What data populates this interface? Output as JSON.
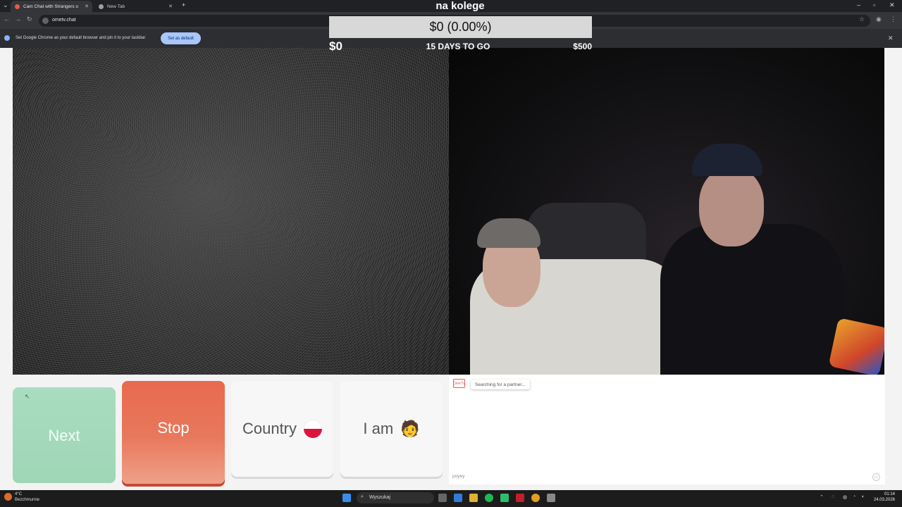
{
  "browser": {
    "tabs": [
      {
        "label": "Cam Chat with Strangers o",
        "active": true
      },
      {
        "label": "New Tab",
        "active": false
      }
    ],
    "new_tab_symbol": "+",
    "url": "ometv.chat",
    "infobar_text": "Set Google Chrome as your default browser and pin it to your taskbar",
    "set_default_label": "Set as default"
  },
  "overlay": {
    "title": "na kolege",
    "goal_text": "$0 (0.00%)",
    "goal_current": "$0",
    "days_to_go": "15 DAYS TO GO",
    "goal_target": "$500",
    "progress_fraction": 0.0
  },
  "controls": {
    "next_label": "Next",
    "stop_label": "Stop",
    "country_label": "Country",
    "country_flag": "flag-poland-icon",
    "iam_label": "I am",
    "iam_icon": "person-emoji-icon"
  },
  "chat": {
    "status": "Searching for a partner...",
    "input_text": "poyey",
    "logo_text": "OmeTV"
  },
  "taskbar": {
    "weather_temp": "4°C",
    "weather_desc": "Bezchmurnie",
    "search_label": "Wyszukaj",
    "time": "01:14",
    "date": "24.03.2026"
  },
  "colors": {
    "next": "#a5dabd",
    "stop": "#e86a4f",
    "card": "#f7f7f7",
    "accent_blue": "#a8c7fa"
  }
}
